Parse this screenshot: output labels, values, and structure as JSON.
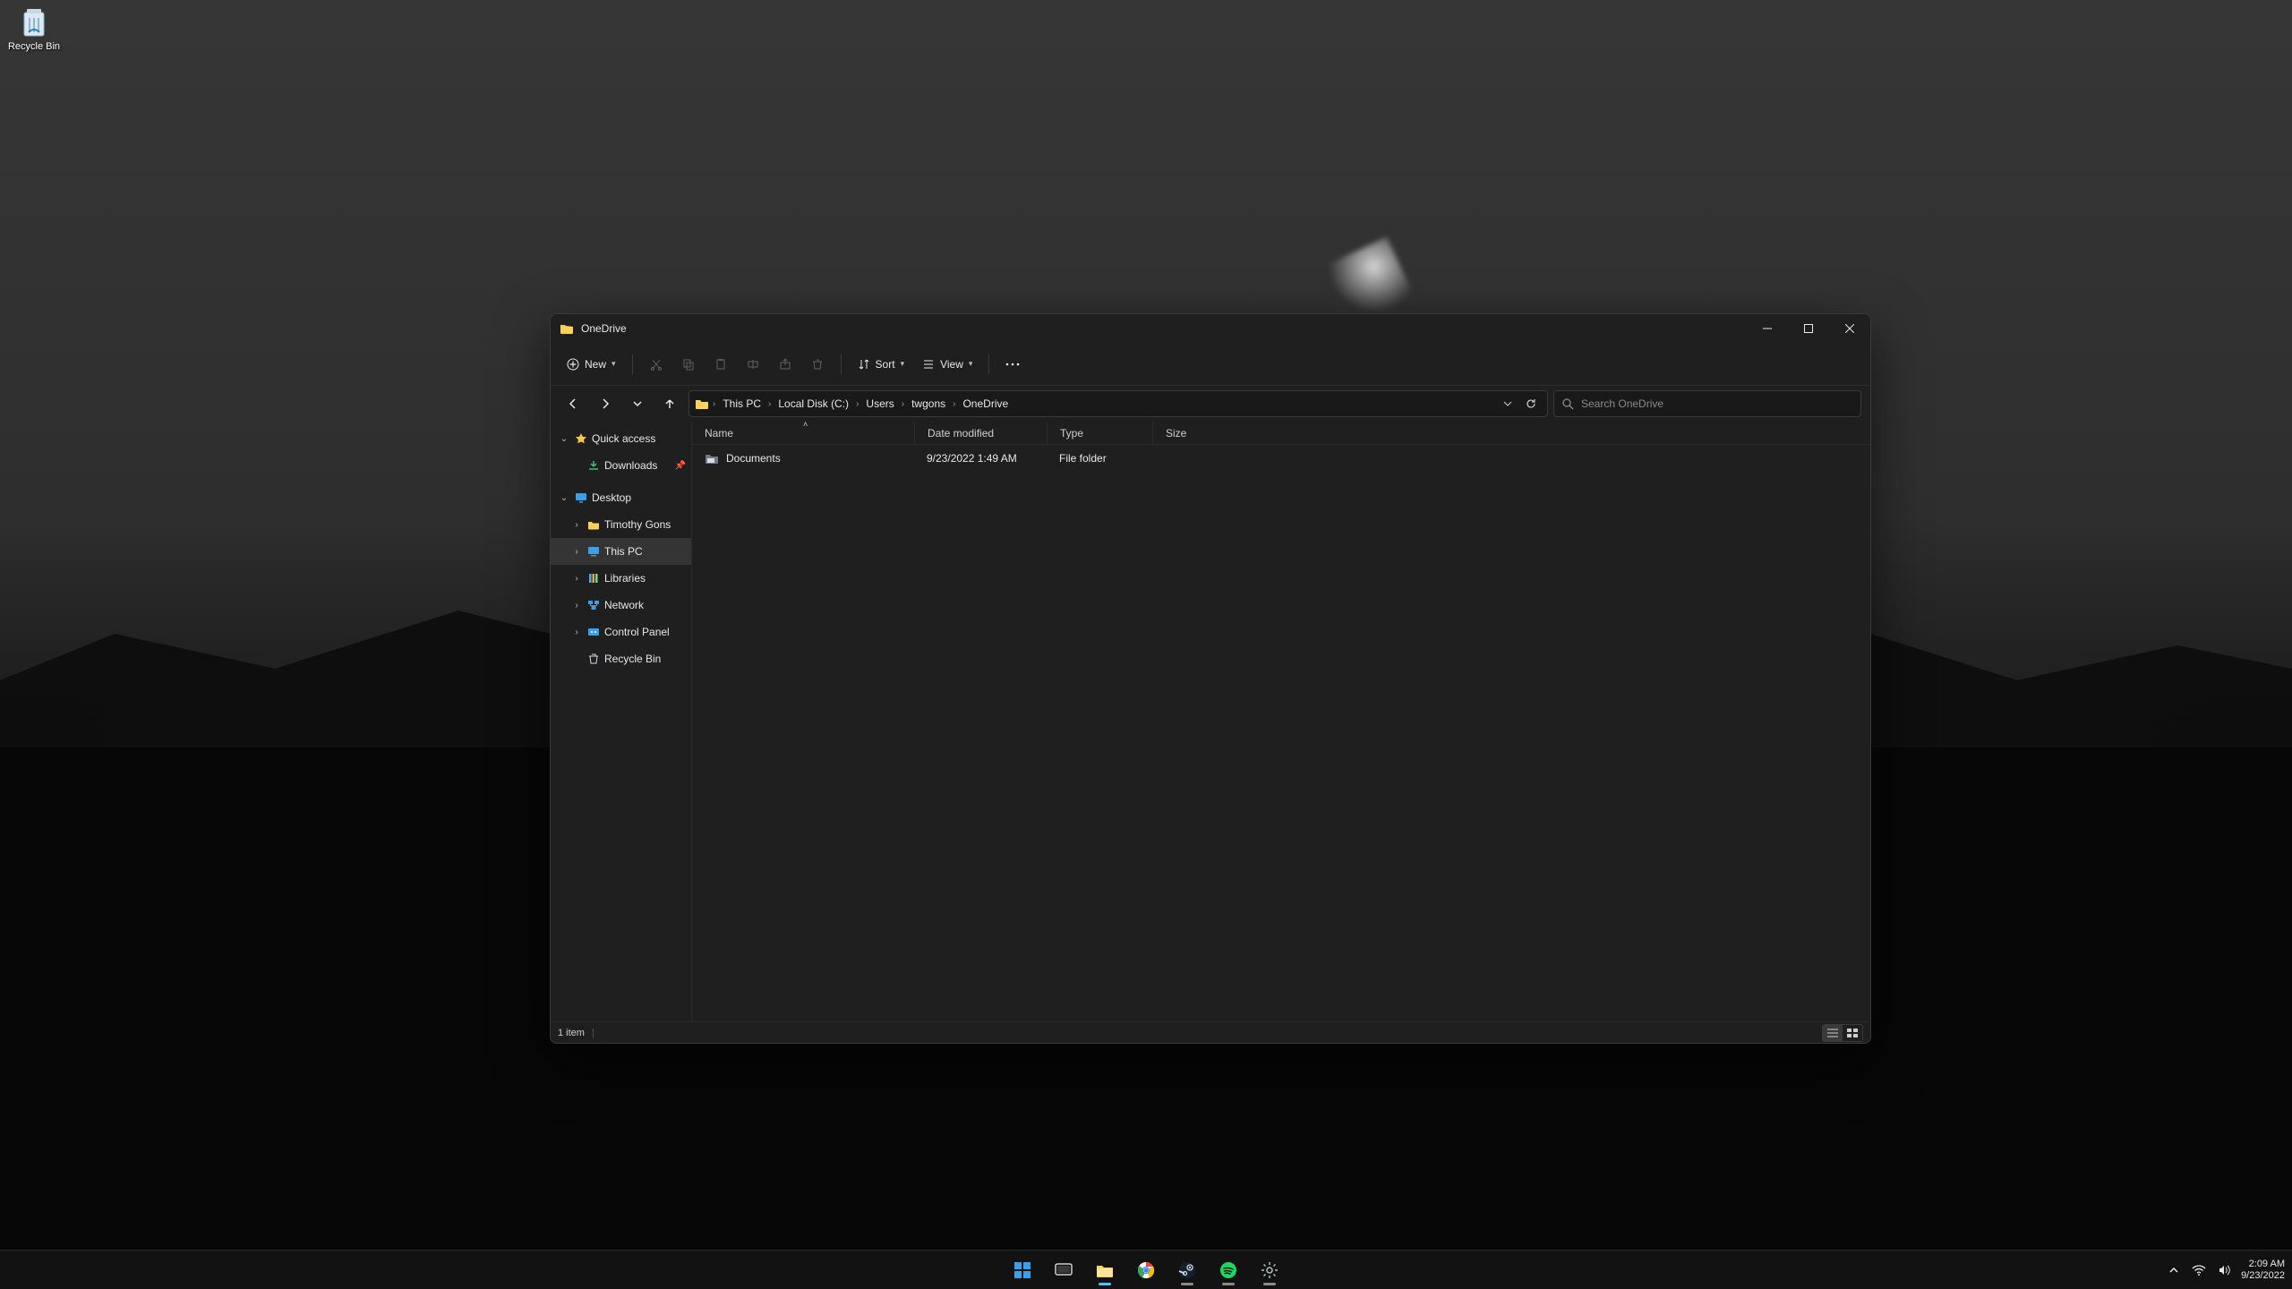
{
  "desktop": {
    "recycle_bin_label": "Recycle Bin"
  },
  "window": {
    "title": "OneDrive",
    "toolbar": {
      "new_label": "New",
      "sort_label": "Sort",
      "view_label": "View"
    },
    "breadcrumbs": [
      "This PC",
      "Local Disk (C:)",
      "Users",
      "twgons",
      "OneDrive"
    ],
    "search_placeholder": "Search OneDrive",
    "sidebar": {
      "quick_access": "Quick access",
      "downloads": "Downloads",
      "desktop": "Desktop",
      "timothy": "Timothy Gons",
      "this_pc": "This PC",
      "libraries": "Libraries",
      "network": "Network",
      "control_panel": "Control Panel",
      "recycle_bin": "Recycle Bin"
    },
    "columns": {
      "name": "Name",
      "date": "Date modified",
      "type": "Type",
      "size": "Size"
    },
    "rows": [
      {
        "name": "Documents",
        "date": "9/23/2022 1:49 AM",
        "type": "File folder",
        "size": ""
      }
    ],
    "status": "1 item"
  },
  "taskbar": {
    "time": "2:09 AM",
    "date": "9/23/2022"
  }
}
